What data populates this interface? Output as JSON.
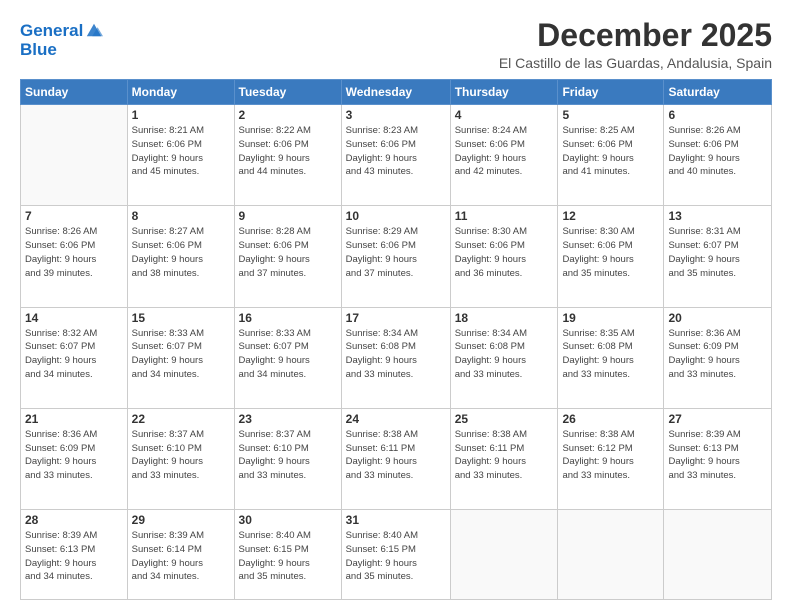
{
  "logo": {
    "line1": "General",
    "line2": "Blue"
  },
  "title": "December 2025",
  "location": "El Castillo de las Guardas, Andalusia, Spain",
  "weekdays": [
    "Sunday",
    "Monday",
    "Tuesday",
    "Wednesday",
    "Thursday",
    "Friday",
    "Saturday"
  ],
  "weeks": [
    [
      {
        "day": "",
        "info": ""
      },
      {
        "day": "1",
        "info": "Sunrise: 8:21 AM\nSunset: 6:06 PM\nDaylight: 9 hours\nand 45 minutes."
      },
      {
        "day": "2",
        "info": "Sunrise: 8:22 AM\nSunset: 6:06 PM\nDaylight: 9 hours\nand 44 minutes."
      },
      {
        "day": "3",
        "info": "Sunrise: 8:23 AM\nSunset: 6:06 PM\nDaylight: 9 hours\nand 43 minutes."
      },
      {
        "day": "4",
        "info": "Sunrise: 8:24 AM\nSunset: 6:06 PM\nDaylight: 9 hours\nand 42 minutes."
      },
      {
        "day": "5",
        "info": "Sunrise: 8:25 AM\nSunset: 6:06 PM\nDaylight: 9 hours\nand 41 minutes."
      },
      {
        "day": "6",
        "info": "Sunrise: 8:26 AM\nSunset: 6:06 PM\nDaylight: 9 hours\nand 40 minutes."
      }
    ],
    [
      {
        "day": "7",
        "info": ""
      },
      {
        "day": "8",
        "info": "Sunrise: 8:27 AM\nSunset: 6:06 PM\nDaylight: 9 hours\nand 38 minutes."
      },
      {
        "day": "9",
        "info": "Sunrise: 8:28 AM\nSunset: 6:06 PM\nDaylight: 9 hours\nand 37 minutes."
      },
      {
        "day": "10",
        "info": "Sunrise: 8:29 AM\nSunset: 6:06 PM\nDaylight: 9 hours\nand 37 minutes."
      },
      {
        "day": "11",
        "info": "Sunrise: 8:30 AM\nSunset: 6:06 PM\nDaylight: 9 hours\nand 36 minutes."
      },
      {
        "day": "12",
        "info": "Sunrise: 8:30 AM\nSunset: 6:06 PM\nDaylight: 9 hours\nand 35 minutes."
      },
      {
        "day": "13",
        "info": "Sunrise: 8:31 AM\nSunset: 6:07 PM\nDaylight: 9 hours\nand 35 minutes."
      }
    ],
    [
      {
        "day": "14",
        "info": ""
      },
      {
        "day": "15",
        "info": "Sunrise: 8:33 AM\nSunset: 6:07 PM\nDaylight: 9 hours\nand 34 minutes."
      },
      {
        "day": "16",
        "info": "Sunrise: 8:33 AM\nSunset: 6:07 PM\nDaylight: 9 hours\nand 34 minutes."
      },
      {
        "day": "17",
        "info": "Sunrise: 8:34 AM\nSunset: 6:08 PM\nDaylight: 9 hours\nand 33 minutes."
      },
      {
        "day": "18",
        "info": "Sunrise: 8:34 AM\nSunset: 6:08 PM\nDaylight: 9 hours\nand 33 minutes."
      },
      {
        "day": "19",
        "info": "Sunrise: 8:35 AM\nSunset: 6:08 PM\nDaylight: 9 hours\nand 33 minutes."
      },
      {
        "day": "20",
        "info": "Sunrise: 8:36 AM\nSunset: 6:09 PM\nDaylight: 9 hours\nand 33 minutes."
      }
    ],
    [
      {
        "day": "21",
        "info": ""
      },
      {
        "day": "22",
        "info": "Sunrise: 8:37 AM\nSunset: 6:10 PM\nDaylight: 9 hours\nand 33 minutes."
      },
      {
        "day": "23",
        "info": "Sunrise: 8:37 AM\nSunset: 6:10 PM\nDaylight: 9 hours\nand 33 minutes."
      },
      {
        "day": "24",
        "info": "Sunrise: 8:38 AM\nSunset: 6:11 PM\nDaylight: 9 hours\nand 33 minutes."
      },
      {
        "day": "25",
        "info": "Sunrise: 8:38 AM\nSunset: 6:11 PM\nDaylight: 9 hours\nand 33 minutes."
      },
      {
        "day": "26",
        "info": "Sunrise: 8:38 AM\nSunset: 6:12 PM\nDaylight: 9 hours\nand 33 minutes."
      },
      {
        "day": "27",
        "info": "Sunrise: 8:39 AM\nSunset: 6:13 PM\nDaylight: 9 hours\nand 33 minutes."
      }
    ],
    [
      {
        "day": "28",
        "info": "Sunrise: 8:39 AM\nSunset: 6:13 PM\nDaylight: 9 hours\nand 34 minutes."
      },
      {
        "day": "29",
        "info": "Sunrise: 8:39 AM\nSunset: 6:14 PM\nDaylight: 9 hours\nand 34 minutes."
      },
      {
        "day": "30",
        "info": "Sunrise: 8:40 AM\nSunset: 6:15 PM\nDaylight: 9 hours\nand 35 minutes."
      },
      {
        "day": "31",
        "info": "Sunrise: 8:40 AM\nSunset: 6:15 PM\nDaylight: 9 hours\nand 35 minutes."
      },
      {
        "day": "",
        "info": ""
      },
      {
        "day": "",
        "info": ""
      },
      {
        "day": "",
        "info": ""
      }
    ]
  ],
  "week1_sun_info": "Sunrise: 8:26 AM\nSunset: 6:06 PM\nDaylight: 9 hours\nand 39 minutes.",
  "week3_sun_info": "Sunrise: 8:32 AM\nSunset: 6:07 PM\nDaylight: 9 hours\nand 34 minutes.",
  "week4_sun_info": "Sunrise: 8:36 AM\nSunset: 6:09 PM\nDaylight: 9 hours\nand 33 minutes."
}
